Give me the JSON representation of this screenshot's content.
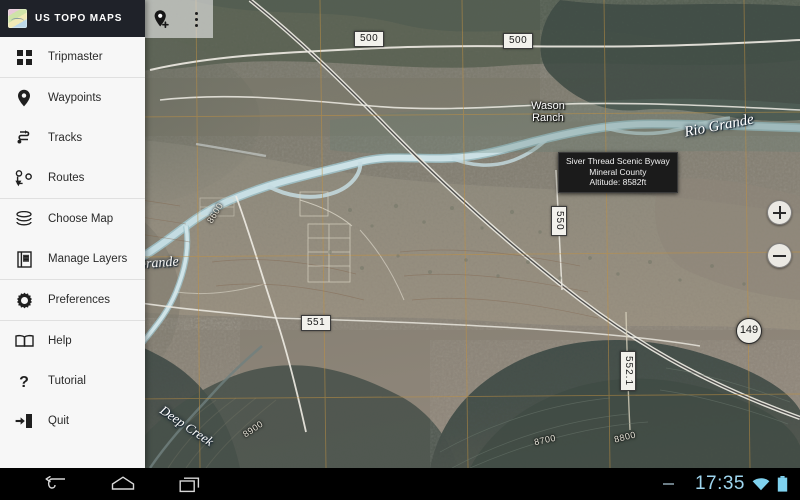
{
  "app": {
    "title": "US TOPO MAPS",
    "icon": "map-tile-icon"
  },
  "sidebar": {
    "groups": [
      {
        "items": [
          {
            "label": "Tripmaster",
            "icon": "grid-icon"
          }
        ]
      },
      {
        "items": [
          {
            "label": "Waypoints",
            "icon": "map-pin-icon"
          },
          {
            "label": "Tracks",
            "icon": "track-path-icon"
          },
          {
            "label": "Routes",
            "icon": "routes-icon"
          }
        ]
      },
      {
        "items": [
          {
            "label": "Choose Map",
            "icon": "layers-stack-icon"
          },
          {
            "label": "Manage Layers",
            "icon": "layers-page-icon"
          }
        ]
      },
      {
        "items": [
          {
            "label": "Preferences",
            "icon": "gear-icon"
          }
        ]
      },
      {
        "items": [
          {
            "label": "Help",
            "icon": "book-icon"
          },
          {
            "label": "Tutorial",
            "icon": "question-mark-icon"
          },
          {
            "label": "Quit",
            "icon": "exit-door-icon"
          }
        ]
      }
    ]
  },
  "map_toolbar": {
    "add_waypoint_icon": "add-waypoint-pin-icon",
    "overflow_icon": "overflow-menu-icon"
  },
  "map_controls": {
    "zoom_in_label": "+",
    "zoom_out_label": "−"
  },
  "callout": {
    "line1": "Siver Thread Scenic Byway",
    "line2": "Mineral County",
    "line3": "Altitude: 8582ft"
  },
  "map_labels": {
    "places": [
      {
        "id": "wason-ranch",
        "text": "Wason\nRanch"
      }
    ],
    "waterways": [
      {
        "id": "rio-grande-east",
        "text": "Rio Grande"
      },
      {
        "id": "rio-grande-west",
        "text": "Grande"
      },
      {
        "id": "deep-creek",
        "text": "Deep Creek"
      }
    ],
    "road_shields": [
      {
        "id": "road-500-west",
        "text": "500"
      },
      {
        "id": "road-500-east",
        "text": "500"
      },
      {
        "id": "road-551",
        "text": "551"
      },
      {
        "id": "road-550",
        "text": "550"
      },
      {
        "id": "road-552-1",
        "text": "552.1"
      }
    ],
    "highway_shields": [
      {
        "id": "hwy-149",
        "text": "149"
      }
    ],
    "contours": [
      {
        "id": "contour-8600",
        "text": "8600"
      },
      {
        "id": "contour-8900",
        "text": "8900"
      },
      {
        "id": "contour-8700",
        "text": "8700"
      },
      {
        "id": "contour-8800",
        "text": "8800"
      }
    ]
  },
  "system_bar": {
    "back_icon": "back-arrow-icon",
    "home_icon": "home-icon",
    "recents_icon": "recent-apps-icon",
    "clock": "17:35",
    "wifi_icon": "wifi-icon",
    "battery_icon": "battery-icon"
  },
  "colors": {
    "header_bg": "#1f2229",
    "sidebar_bg": "#f7f7f7",
    "accent": "#9fd6ef",
    "callout_bg": "#1b1b1b"
  }
}
